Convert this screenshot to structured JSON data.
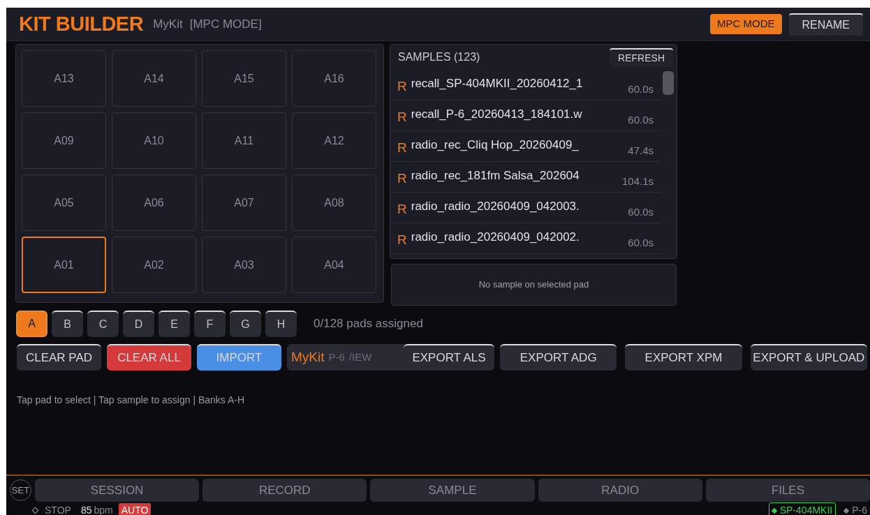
{
  "header": {
    "title": "KIT BUILDER",
    "kit_name": "MyKit",
    "mode_label": "[MPC MODE]",
    "buttons": [
      {
        "label": "MPC MODE",
        "active": true
      },
      {
        "label": "RENAME",
        "active": false
      }
    ]
  },
  "pads": [
    [
      {
        "label": "A13",
        "selected": false
      },
      {
        "label": "A14",
        "selected": false
      },
      {
        "label": "A15",
        "selected": false
      },
      {
        "label": "A16",
        "selected": false
      }
    ],
    [
      {
        "label": "A09",
        "selected": false
      },
      {
        "label": "A10",
        "selected": false
      },
      {
        "label": "A11",
        "selected": false
      },
      {
        "label": "A12",
        "selected": false
      }
    ],
    [
      {
        "label": "A05",
        "selected": false
      },
      {
        "label": "A06",
        "selected": false
      },
      {
        "label": "A07",
        "selected": false
      },
      {
        "label": "A08",
        "selected": false
      }
    ],
    [
      {
        "label": "A01",
        "selected": true
      },
      {
        "label": "A02",
        "selected": false
      },
      {
        "label": "A03",
        "selected": false
      },
      {
        "label": "A04",
        "selected": false
      }
    ]
  ],
  "samples": {
    "title": "SAMPLES (123)",
    "refresh": "REFRESH",
    "items": [
      {
        "badge": "R",
        "name": "recall_SP-404MKII_20260412_1",
        "duration": "60.0s"
      },
      {
        "badge": "R",
        "name": "recall_P-6_20260413_184101.w",
        "duration": "60.0s"
      },
      {
        "badge": "R",
        "name": "radio_rec_Cliq Hop_20260409_",
        "duration": "47.4s"
      },
      {
        "badge": "R",
        "name": "radio_rec_181fm Salsa_202604",
        "duration": "104.1s"
      },
      {
        "badge": "R",
        "name": "radio_radio_20260409_042003.",
        "duration": "60.0s"
      },
      {
        "badge": "R",
        "name": "radio_radio_20260409_042002.",
        "duration": "60.0s"
      }
    ]
  },
  "pad_info": "No sample on selected pad",
  "banks": [
    {
      "label": "A",
      "selected": true
    },
    {
      "label": "B",
      "selected": false
    },
    {
      "label": "C",
      "selected": false
    },
    {
      "label": "D",
      "selected": false
    },
    {
      "label": "E",
      "selected": false
    },
    {
      "label": "F",
      "selected": false
    },
    {
      "label": "G",
      "selected": false
    },
    {
      "label": "H",
      "selected": false
    }
  ],
  "pads_assigned": "0/128 pads assigned",
  "actions": [
    {
      "label": "CLEAR PAD",
      "kind": "default"
    },
    {
      "label": "CLEAR ALL",
      "kind": "danger"
    },
    {
      "label": "IMPORT",
      "kind": "primary"
    }
  ],
  "overlay": {
    "label": "MyKit",
    "texts": [
      "P-6",
      "/IEW"
    ]
  },
  "exports": [
    "EXPORT ALS",
    "EXPORT ADG",
    "EXPORT XPM",
    "EXPORT & UPLOAD"
  ],
  "hint": "Tap pad to select | Tap sample to assign | Banks A-H",
  "nav": {
    "settings": "SET",
    "tabs": [
      {
        "label": "SESSION",
        "selected": false
      },
      {
        "label": "RECORD",
        "selected": false
      },
      {
        "label": "SAMPLE",
        "selected": false
      },
      {
        "label": "RADIO",
        "selected": false
      },
      {
        "label": "FILES",
        "selected": false
      }
    ]
  },
  "status": {
    "transport": "STOP",
    "bpm": "85",
    "bpm_unit": "bpm",
    "auto": "AUTO",
    "devices": [
      {
        "label": "SP-404MKII",
        "connected": true
      },
      {
        "label": "P-6",
        "connected": false
      }
    ]
  }
}
